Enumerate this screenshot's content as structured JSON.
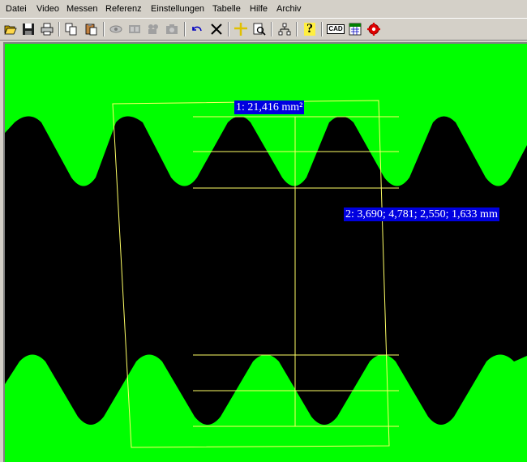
{
  "menu": {
    "items": [
      "Datei",
      "Video",
      "Messen",
      "Referenz",
      "Einstellungen",
      "Tabelle",
      "Hilfe",
      "Archiv"
    ]
  },
  "toolbar": {
    "cad_label": "CAD",
    "help_label": "?"
  },
  "measurements": {
    "area_label": "1: 21,416 mm²",
    "distance_label": "2: 3,690; 4,781; 2,550; 1,633 mm"
  },
  "colors": {
    "background_green": "#00ff00",
    "part_black": "#000000",
    "overlay_yellow": "#ffff66",
    "label_blue": "#0000e0"
  }
}
